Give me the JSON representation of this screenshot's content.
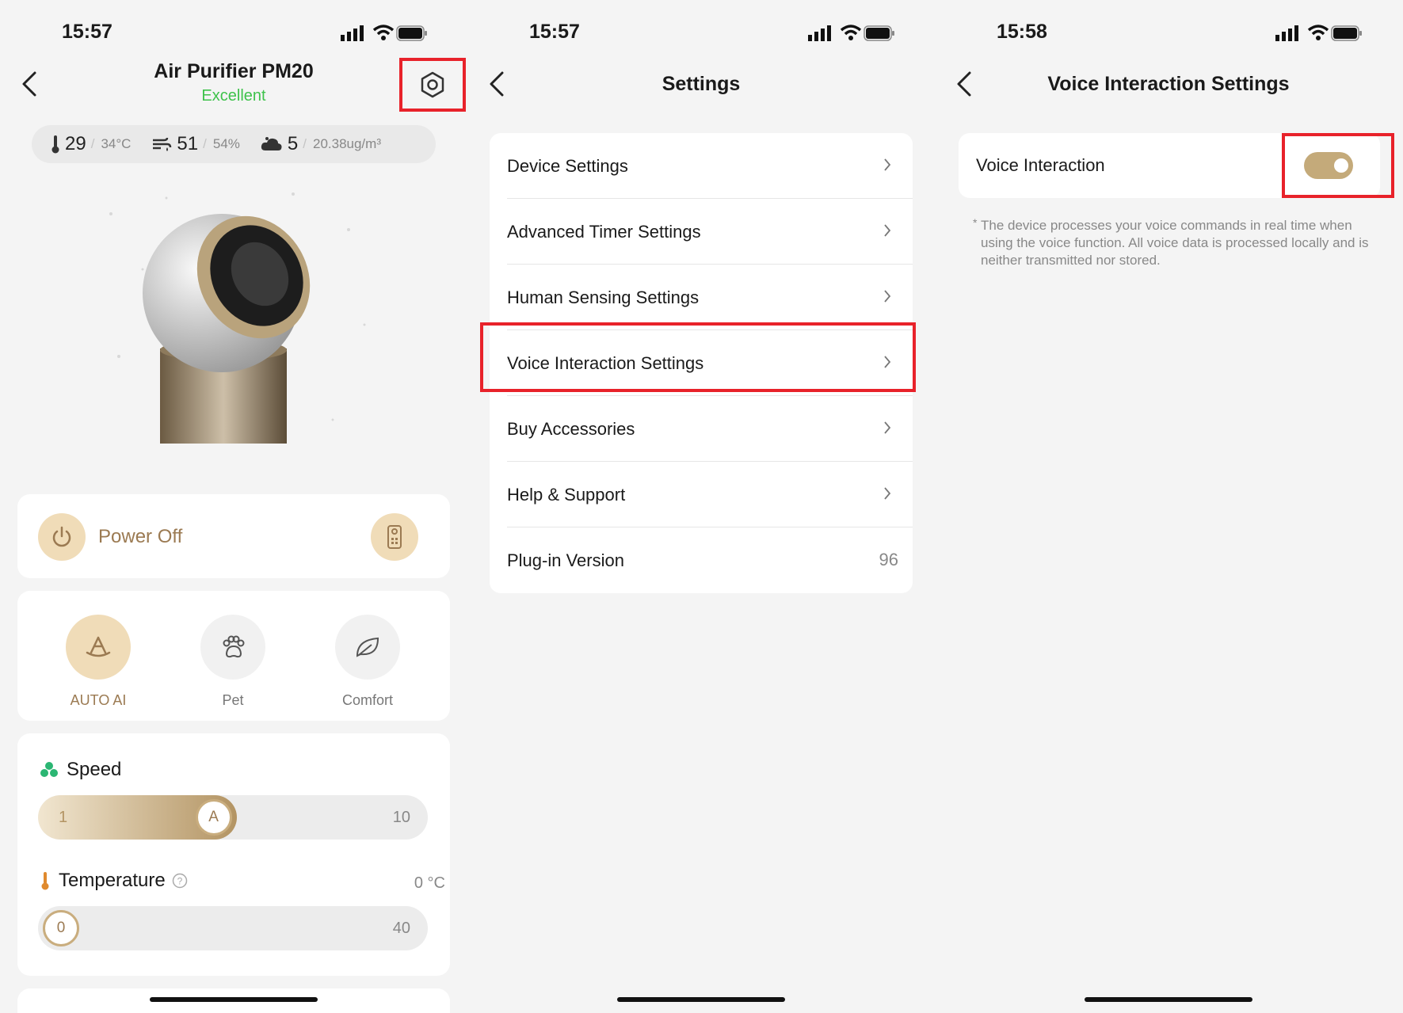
{
  "screen1": {
    "time": "15:57",
    "device_title": "Air Purifier PM20",
    "air_quality": "Excellent",
    "metrics": [
      {
        "icon": "thermometer-icon",
        "value": "29",
        "sub": "34°C"
      },
      {
        "icon": "humidity-wind-icon",
        "value": "51",
        "sub": "54%"
      },
      {
        "icon": "pm25-cloud-icon",
        "value": "5",
        "sub": "20.38ug/m³"
      }
    ],
    "power_label": "Power Off",
    "modes": [
      {
        "label": "AUTO AI",
        "icon": "auto-ai-icon",
        "active": true
      },
      {
        "label": "Pet",
        "icon": "paw-icon",
        "active": false
      },
      {
        "label": "Comfort",
        "icon": "leaf-icon",
        "active": false
      }
    ],
    "speed": {
      "title": "Speed",
      "min": "1",
      "max": "10",
      "knob": "A",
      "level": 0.45
    },
    "temperature": {
      "title": "Temperature",
      "value": "0 °C",
      "min": "0",
      "max": "40",
      "knob": "0",
      "level": 0
    }
  },
  "screen2": {
    "time": "15:57",
    "title": "Settings",
    "items": [
      {
        "label": "Device Settings"
      },
      {
        "label": "Advanced Timer Settings"
      },
      {
        "label": "Human Sensing Settings"
      },
      {
        "label": "Voice Interaction Settings"
      },
      {
        "label": "Buy Accessories"
      },
      {
        "label": "Help & Support"
      },
      {
        "label": "Plug-in Version",
        "value": "96"
      }
    ]
  },
  "screen3": {
    "time": "15:58",
    "title": "Voice Interaction Settings",
    "voice_label": "Voice Interaction",
    "voice_enabled": true,
    "note_asterisk": "*",
    "note": "The device processes your voice commands in real time when using the voice function. All voice data is processed locally and is neither transmitted nor stored."
  },
  "colors": {
    "accent": "#c4aa7a",
    "highlight": "#e8222a",
    "status_good": "#3ec24b"
  }
}
